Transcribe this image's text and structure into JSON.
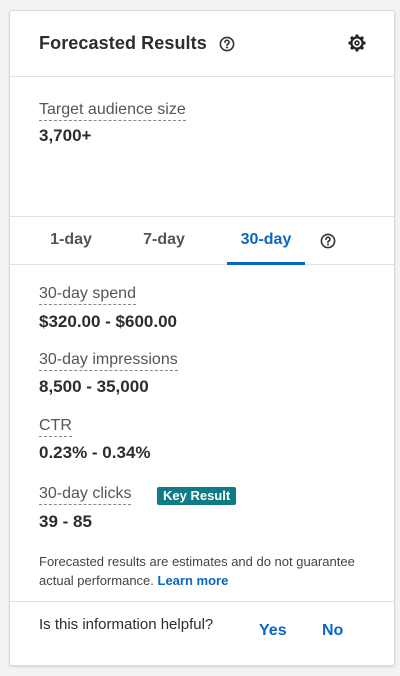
{
  "header": {
    "title": "Forecasted Results"
  },
  "audience": {
    "label": "Target audience size",
    "value": "3,700+"
  },
  "tabs": [
    {
      "label": "1-day",
      "active": false
    },
    {
      "label": "7-day",
      "active": false
    },
    {
      "label": "30-day",
      "active": true
    }
  ],
  "metrics": [
    {
      "label": "30-day spend",
      "value": "$320.00 - $600.00"
    },
    {
      "label": "30-day impressions",
      "value": "8,500 - 35,000"
    },
    {
      "label": "CTR",
      "value": "0.23% - 0.34%"
    },
    {
      "label": "30-day clicks",
      "value": "39 - 85",
      "badge": "Key Result"
    }
  ],
  "disclaimer": {
    "text": "Forecasted results are estimates and do not guarantee actual performance. ",
    "link": "Learn more"
  },
  "footer": {
    "question": "Is this information helpful?",
    "yes": "Yes",
    "no": "No"
  },
  "colors": {
    "accent": "#0a66c2",
    "badge": "#0f7b86"
  },
  "icons": {
    "help": "question-circle-icon",
    "settings": "gear-icon"
  }
}
